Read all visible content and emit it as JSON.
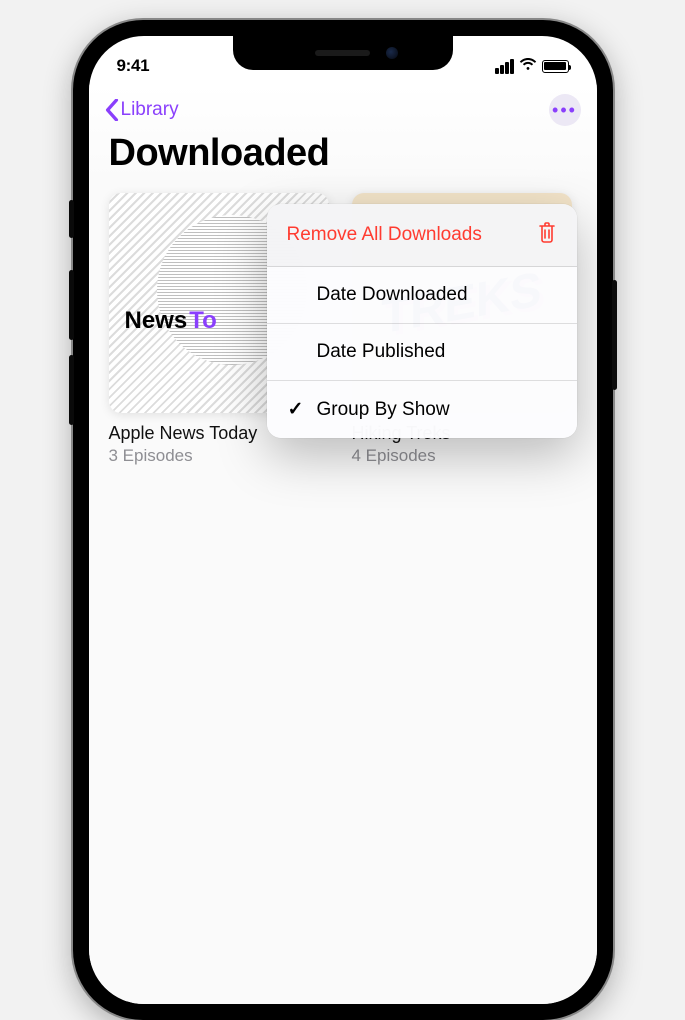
{
  "status": {
    "time": "9:41"
  },
  "nav": {
    "back_label": "Library"
  },
  "page": {
    "title": "Downloaded"
  },
  "shows": [
    {
      "title": "Apple News Today",
      "subtitle": "3 Episodes",
      "brand_prefix": "News",
      "brand_suffix": "To"
    },
    {
      "title": "Hiking Treks",
      "subtitle": "4 Episodes",
      "art_text": "TREKS"
    }
  ],
  "menu": {
    "remove_label": "Remove All Downloads",
    "date_downloaded_label": "Date Downloaded",
    "date_published_label": "Date Published",
    "group_label": "Group By Show"
  },
  "colors": {
    "accent": "#8a3ffc",
    "destructive": "#ff3b30"
  }
}
